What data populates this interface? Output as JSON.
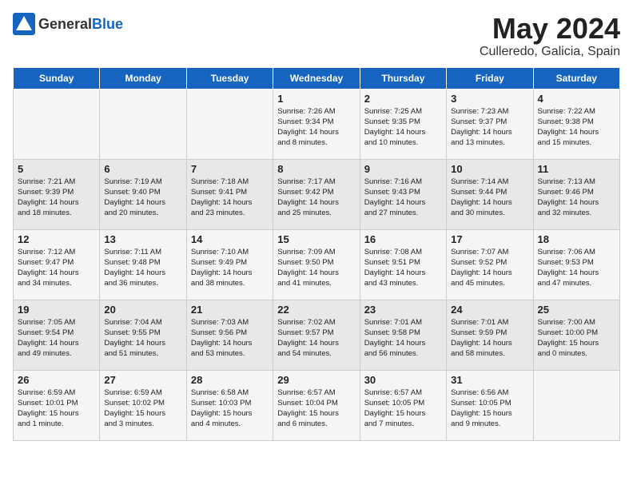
{
  "header": {
    "logo_general": "General",
    "logo_blue": "Blue",
    "month": "May 2024",
    "location": "Culleredo, Galicia, Spain"
  },
  "weekdays": [
    "Sunday",
    "Monday",
    "Tuesday",
    "Wednesday",
    "Thursday",
    "Friday",
    "Saturday"
  ],
  "weeks": [
    [
      {
        "day": "",
        "info": ""
      },
      {
        "day": "",
        "info": ""
      },
      {
        "day": "",
        "info": ""
      },
      {
        "day": "1",
        "info": "Sunrise: 7:26 AM\nSunset: 9:34 PM\nDaylight: 14 hours\nand 8 minutes."
      },
      {
        "day": "2",
        "info": "Sunrise: 7:25 AM\nSunset: 9:35 PM\nDaylight: 14 hours\nand 10 minutes."
      },
      {
        "day": "3",
        "info": "Sunrise: 7:23 AM\nSunset: 9:37 PM\nDaylight: 14 hours\nand 13 minutes."
      },
      {
        "day": "4",
        "info": "Sunrise: 7:22 AM\nSunset: 9:38 PM\nDaylight: 14 hours\nand 15 minutes."
      }
    ],
    [
      {
        "day": "5",
        "info": "Sunrise: 7:21 AM\nSunset: 9:39 PM\nDaylight: 14 hours\nand 18 minutes."
      },
      {
        "day": "6",
        "info": "Sunrise: 7:19 AM\nSunset: 9:40 PM\nDaylight: 14 hours\nand 20 minutes."
      },
      {
        "day": "7",
        "info": "Sunrise: 7:18 AM\nSunset: 9:41 PM\nDaylight: 14 hours\nand 23 minutes."
      },
      {
        "day": "8",
        "info": "Sunrise: 7:17 AM\nSunset: 9:42 PM\nDaylight: 14 hours\nand 25 minutes."
      },
      {
        "day": "9",
        "info": "Sunrise: 7:16 AM\nSunset: 9:43 PM\nDaylight: 14 hours\nand 27 minutes."
      },
      {
        "day": "10",
        "info": "Sunrise: 7:14 AM\nSunset: 9:44 PM\nDaylight: 14 hours\nand 30 minutes."
      },
      {
        "day": "11",
        "info": "Sunrise: 7:13 AM\nSunset: 9:46 PM\nDaylight: 14 hours\nand 32 minutes."
      }
    ],
    [
      {
        "day": "12",
        "info": "Sunrise: 7:12 AM\nSunset: 9:47 PM\nDaylight: 14 hours\nand 34 minutes."
      },
      {
        "day": "13",
        "info": "Sunrise: 7:11 AM\nSunset: 9:48 PM\nDaylight: 14 hours\nand 36 minutes."
      },
      {
        "day": "14",
        "info": "Sunrise: 7:10 AM\nSunset: 9:49 PM\nDaylight: 14 hours\nand 38 minutes."
      },
      {
        "day": "15",
        "info": "Sunrise: 7:09 AM\nSunset: 9:50 PM\nDaylight: 14 hours\nand 41 minutes."
      },
      {
        "day": "16",
        "info": "Sunrise: 7:08 AM\nSunset: 9:51 PM\nDaylight: 14 hours\nand 43 minutes."
      },
      {
        "day": "17",
        "info": "Sunrise: 7:07 AM\nSunset: 9:52 PM\nDaylight: 14 hours\nand 45 minutes."
      },
      {
        "day": "18",
        "info": "Sunrise: 7:06 AM\nSunset: 9:53 PM\nDaylight: 14 hours\nand 47 minutes."
      }
    ],
    [
      {
        "day": "19",
        "info": "Sunrise: 7:05 AM\nSunset: 9:54 PM\nDaylight: 14 hours\nand 49 minutes."
      },
      {
        "day": "20",
        "info": "Sunrise: 7:04 AM\nSunset: 9:55 PM\nDaylight: 14 hours\nand 51 minutes."
      },
      {
        "day": "21",
        "info": "Sunrise: 7:03 AM\nSunset: 9:56 PM\nDaylight: 14 hours\nand 53 minutes."
      },
      {
        "day": "22",
        "info": "Sunrise: 7:02 AM\nSunset: 9:57 PM\nDaylight: 14 hours\nand 54 minutes."
      },
      {
        "day": "23",
        "info": "Sunrise: 7:01 AM\nSunset: 9:58 PM\nDaylight: 14 hours\nand 56 minutes."
      },
      {
        "day": "24",
        "info": "Sunrise: 7:01 AM\nSunset: 9:59 PM\nDaylight: 14 hours\nand 58 minutes."
      },
      {
        "day": "25",
        "info": "Sunrise: 7:00 AM\nSunset: 10:00 PM\nDaylight: 15 hours\nand 0 minutes."
      }
    ],
    [
      {
        "day": "26",
        "info": "Sunrise: 6:59 AM\nSunset: 10:01 PM\nDaylight: 15 hours\nand 1 minute."
      },
      {
        "day": "27",
        "info": "Sunrise: 6:59 AM\nSunset: 10:02 PM\nDaylight: 15 hours\nand 3 minutes."
      },
      {
        "day": "28",
        "info": "Sunrise: 6:58 AM\nSunset: 10:03 PM\nDaylight: 15 hours\nand 4 minutes."
      },
      {
        "day": "29",
        "info": "Sunrise: 6:57 AM\nSunset: 10:04 PM\nDaylight: 15 hours\nand 6 minutes."
      },
      {
        "day": "30",
        "info": "Sunrise: 6:57 AM\nSunset: 10:05 PM\nDaylight: 15 hours\nand 7 minutes."
      },
      {
        "day": "31",
        "info": "Sunrise: 6:56 AM\nSunset: 10:05 PM\nDaylight: 15 hours\nand 9 minutes."
      },
      {
        "day": "",
        "info": ""
      }
    ]
  ]
}
